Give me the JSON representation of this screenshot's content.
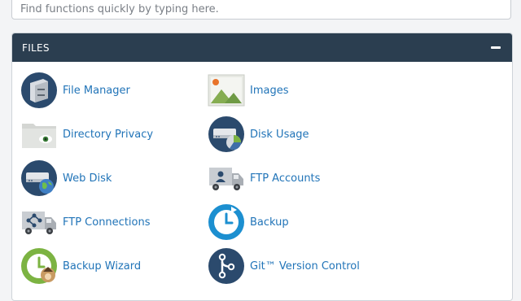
{
  "search": {
    "placeholder": "Find functions quickly by typing here."
  },
  "panel": {
    "title": "FILES"
  },
  "items": [
    {
      "label": "File Manager",
      "icon": "file-manager-icon"
    },
    {
      "label": "Images",
      "icon": "images-icon"
    },
    {
      "label": "Directory Privacy",
      "icon": "directory-privacy-icon"
    },
    {
      "label": "Disk Usage",
      "icon": "disk-usage-icon"
    },
    {
      "label": "Web Disk",
      "icon": "web-disk-icon"
    },
    {
      "label": "FTP Accounts",
      "icon": "ftp-accounts-icon"
    },
    {
      "label": "FTP Connections",
      "icon": "ftp-connections-icon"
    },
    {
      "label": "Backup",
      "icon": "backup-icon"
    },
    {
      "label": "Backup Wizard",
      "icon": "backup-wizard-icon"
    },
    {
      "label": "Git™ Version Control",
      "icon": "git-version-control-icon"
    }
  ],
  "colors": {
    "header": "#2b3e50",
    "link": "#2174b8",
    "icon_navy": "#2b4a6d"
  }
}
